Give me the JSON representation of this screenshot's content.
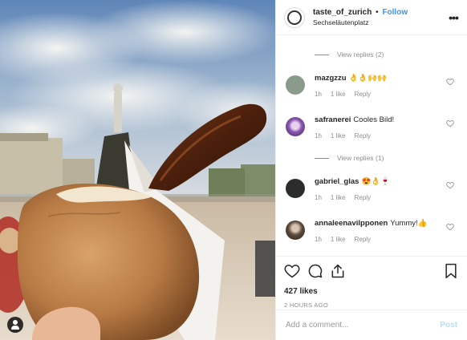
{
  "post": {
    "username": "taste_of_zurich",
    "separator": "•",
    "follow_label": "Follow",
    "location": "Sechseläutenplatz",
    "more_icon": "more-horizontal-icon"
  },
  "comments": {
    "view_replies_1": "View replies (2)",
    "view_replies_2": "View replies (1)",
    "items": [
      {
        "user": "mazgzzu",
        "text": "👌👌🙌🙌",
        "time": "1h",
        "likes": "1 like",
        "reply": "Reply"
      },
      {
        "user": "safranerei",
        "text": "Cooles Bild!",
        "time": "1h",
        "likes": "1 like",
        "reply": "Reply"
      },
      {
        "user": "gabriel_glas",
        "text": "😍👌🍷",
        "time": "1h",
        "likes": "1 like",
        "reply": "Reply"
      },
      {
        "user": "annaleenavilpponen",
        "text": "Yummy!👍",
        "time": "1h",
        "likes": "1 like",
        "reply": "Reply"
      }
    ]
  },
  "actions": {
    "likes": "427 likes",
    "timestamp": "2 HOURS AGO",
    "icons": [
      "heart-icon",
      "comment-icon",
      "share-icon",
      "bookmark-icon"
    ]
  },
  "add_comment": {
    "placeholder": "Add a comment...",
    "post_label": "Post"
  },
  "colors": {
    "link": "#3897f0",
    "post_disabled": "#b2dffc",
    "muted": "#8e8e8e",
    "text": "#262626"
  }
}
